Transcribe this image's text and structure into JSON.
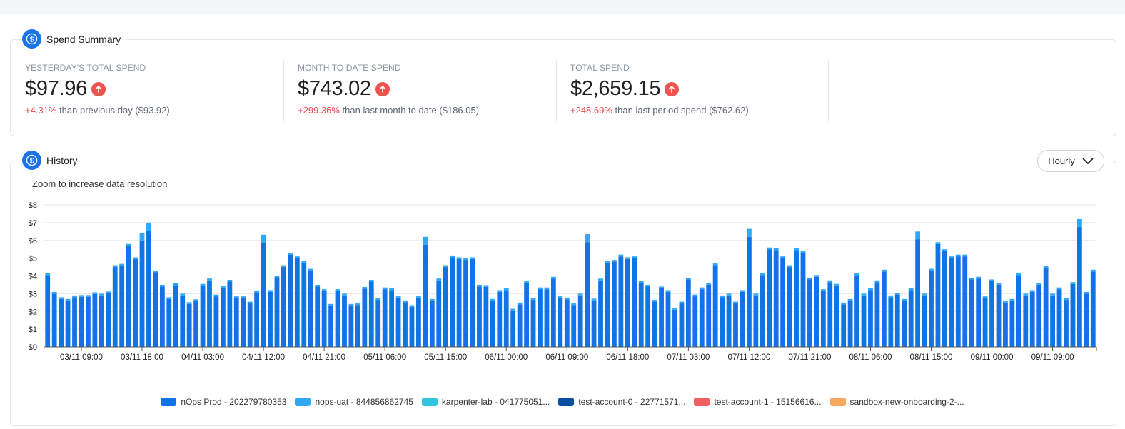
{
  "spend_summary": {
    "title": "Spend Summary",
    "icon": "dollar-circle-icon",
    "metrics": [
      {
        "label": "YESTERDAY'S TOTAL SPEND",
        "value": "$97.96",
        "trend_icon": "arrow-up-icon",
        "change_pct": "+4.31%",
        "change_text": " than previous day ($93.92)"
      },
      {
        "label": "MONTH TO DATE SPEND",
        "value": "$743.02",
        "trend_icon": "arrow-up-icon",
        "change_pct": "+299.36%",
        "change_text": " than last month to date ($186.05)"
      },
      {
        "label": "TOTAL SPEND",
        "value": "$2,659.15",
        "trend_icon": "arrow-up-icon",
        "change_pct": "+248.69%",
        "change_text": " than last period spend ($762.62)"
      }
    ]
  },
  "history": {
    "title": "History",
    "icon": "dollar-circle-icon",
    "granularity": "Hourly",
    "hint": "Zoom to increase data resolution"
  },
  "colors": {
    "accent": "#1a73e8",
    "up": "#ef5350",
    "pct_text": "#e5484d"
  },
  "chart_data": {
    "type": "bar",
    "stacked": true,
    "title": "",
    "xlabel": "",
    "ylabel": "",
    "ylim": [
      0,
      8
    ],
    "yticks": [
      "$0",
      "$1",
      "$2",
      "$3",
      "$4",
      "$5",
      "$6",
      "$7",
      "$8"
    ],
    "grid": true,
    "legend_position": "bottom",
    "x_start": "03/11 04:00",
    "x_step": "1 hour",
    "xtick_labels": [
      "03/11 09:00",
      "03/11 18:00",
      "04/11 03:00",
      "04/11 12:00",
      "04/11 21:00",
      "05/11 06:00",
      "05/11 15:00",
      "06/11 00:00",
      "06/11 09:00",
      "06/11 18:00",
      "07/11 03:00",
      "07/11 12:00",
      "07/11 21:00",
      "08/11 06:00",
      "08/11 15:00",
      "09/11 00:00",
      "09/11 09:00"
    ],
    "xtick_first_index": 5,
    "xtick_every": 9,
    "totals": [
      4.15,
      3.1,
      2.8,
      2.7,
      2.9,
      2.92,
      2.92,
      3.08,
      3.0,
      3.12,
      4.6,
      4.68,
      5.8,
      5.05,
      6.4,
      7.0,
      4.3,
      3.5,
      2.8,
      3.58,
      3.0,
      2.52,
      2.68,
      3.55,
      3.85,
      2.95,
      3.45,
      3.78,
      2.85,
      2.85,
      2.55,
      3.18,
      6.32,
      3.2,
      4.02,
      4.6,
      5.3,
      5.1,
      4.85,
      4.4,
      3.5,
      3.25,
      2.42,
      3.25,
      3.0,
      2.42,
      2.45,
      3.38,
      3.78,
      2.75,
      3.35,
      3.3,
      2.88,
      2.62,
      2.35,
      2.88,
      6.2,
      2.7,
      3.85,
      4.6,
      5.15,
      5.05,
      5.0,
      5.05,
      3.5,
      3.48,
      2.7,
      3.2,
      3.3,
      2.15,
      2.5,
      3.7,
      2.75,
      3.35,
      3.35,
      3.95,
      2.85,
      2.78,
      2.45,
      3.0,
      6.35,
      2.72,
      3.85,
      4.85,
      4.9,
      5.2,
      5.05,
      5.1,
      3.7,
      3.5,
      2.65,
      3.4,
      3.2,
      2.2,
      2.55,
      3.9,
      2.95,
      3.35,
      3.6,
      4.7,
      2.9,
      3.0,
      2.55,
      3.2,
      6.65,
      3.0,
      4.15,
      5.6,
      5.55,
      5.1,
      4.6,
      5.55,
      5.4,
      3.9,
      4.05,
      3.25,
      3.75,
      3.55,
      2.5,
      2.7,
      4.15,
      3.0,
      3.3,
      3.75,
      4.35,
      2.9,
      3.05,
      2.7,
      3.3,
      6.5,
      3.0,
      4.4,
      5.9,
      5.5,
      5.1,
      5.2,
      5.2,
      3.9,
      3.95,
      2.85,
      3.8,
      3.6,
      2.6,
      2.7,
      4.15,
      3.0,
      3.2,
      3.6,
      4.55,
      3.0,
      3.35,
      2.75,
      3.65,
      7.2,
      3.1,
      4.35
    ],
    "series": [
      {
        "name": "nOps Prod - 202279780353",
        "color": "#1273e6",
        "share_of_total": "remainder"
      },
      {
        "name": "nops-uat - 844856862745",
        "color": "#2fa9f5",
        "typical_value": 0.1,
        "spike_value": 0.45
      },
      {
        "name": "karpenter-lab - 041775051...",
        "color": "#32c5e0",
        "typical_value": 0
      },
      {
        "name": "test-account-0 - 22771571...",
        "color": "#0b4fa3",
        "typical_value": 0
      },
      {
        "name": "test-account-1 - 15156616...",
        "color": "#f06060",
        "typical_value": 0
      },
      {
        "name": "sandbox-new-onboarding-2-...",
        "color": "#f8a960",
        "typical_value": 0
      }
    ]
  }
}
